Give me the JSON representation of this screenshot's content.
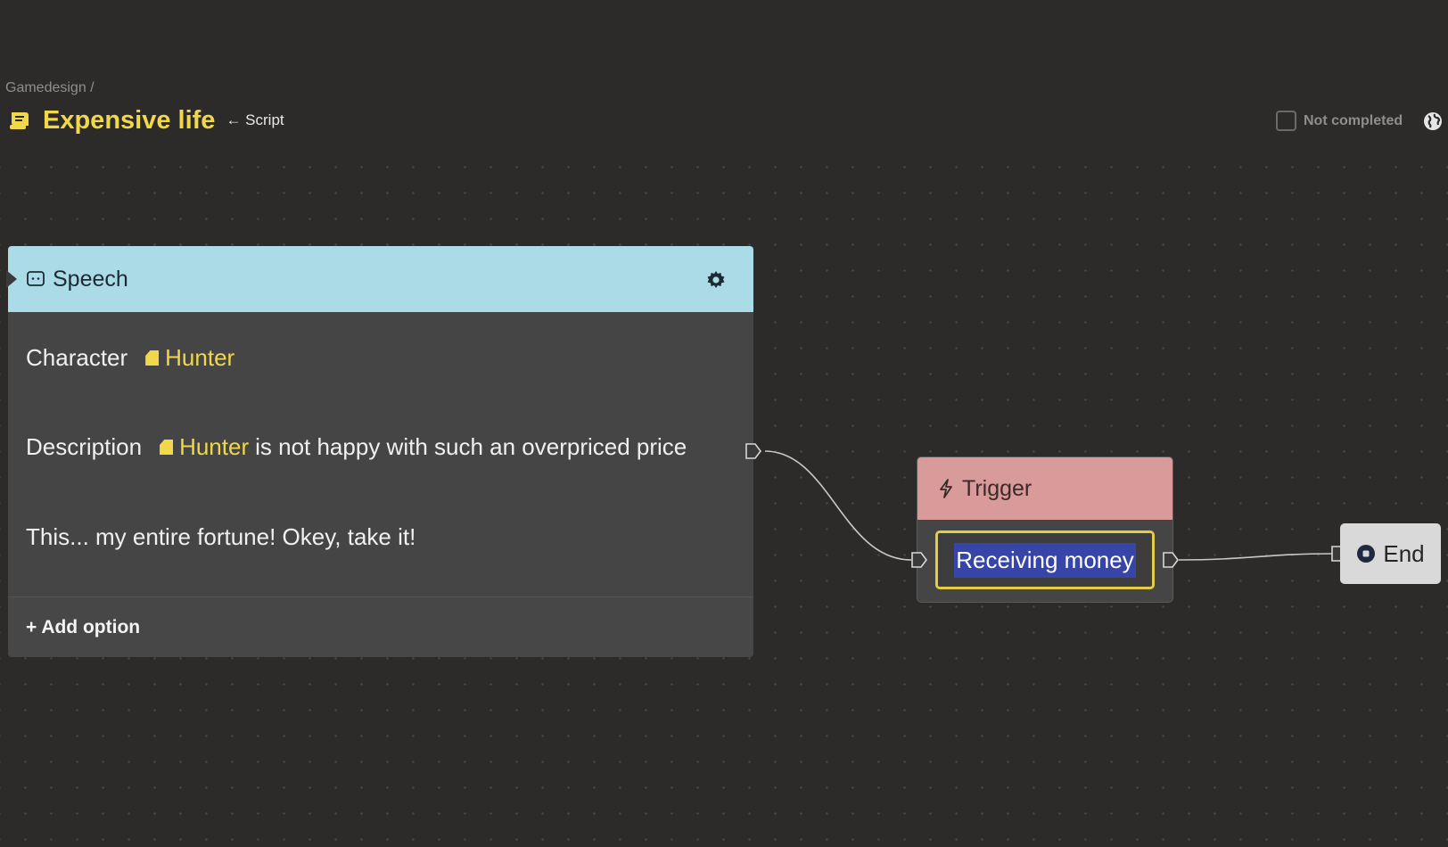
{
  "header": {
    "breadcrumb": "Gamedesign /",
    "title": "Expensive life",
    "back_link": "← Script",
    "status_label": "Not completed",
    "title_icon": "script-icon",
    "globe_icon": "globe-icon"
  },
  "speech_node": {
    "label": "Speech",
    "character_key": "Character",
    "character_value": "Hunter",
    "description_key": "Description",
    "description_chip": "Hunter",
    "description_text": "is not happy with such an overpriced price",
    "line": "This... my entire fortune! Okey, take it!",
    "add_option": "+ Add option",
    "header_color": "#acdbe8"
  },
  "trigger_node": {
    "label": "Trigger",
    "value": "Receiving money",
    "header_color": "#d99a9a"
  },
  "end_node": {
    "label": "End"
  },
  "colors": {
    "accent": "#f0d84a",
    "selection": "#3744a8",
    "background": "#2c2b2a"
  }
}
